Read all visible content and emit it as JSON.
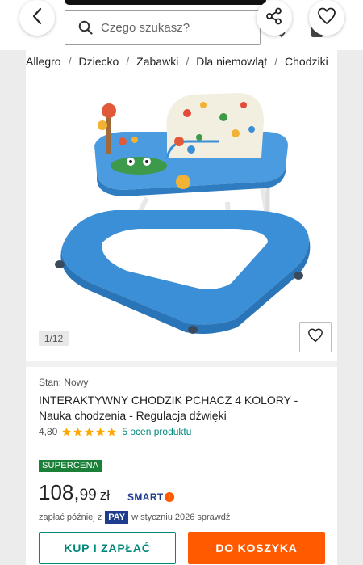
{
  "header": {
    "search_placeholder": "Czego szukasz?"
  },
  "breadcrumb": [
    "Allegro",
    "Dziecko",
    "Zabawki",
    "Dla niemowląt",
    "Chodziki"
  ],
  "gallery": {
    "counter": "1/12"
  },
  "product": {
    "condition": "Stan: Nowy",
    "title": "INTERAKTYWNY CHODZIK PCHACZ 4 KOLORY - Nauka chodzenia - Regulacja dźwięki",
    "rating_value": "4,80",
    "stars": 5,
    "reviews_link": "5 ocen produktu",
    "badge": "SUPERCENA",
    "price_int": "108,",
    "price_dec": "99",
    "currency": "zł",
    "smart_label": "SMART!",
    "pay_later_before": "zapłać później z",
    "pay_logo": "PAY",
    "pay_later_after": "w styczniu 2026 sprawdź"
  },
  "actions": {
    "buy_label": "KUP I ZAPŁAĆ",
    "cart_label": "DO KOSZYKA"
  },
  "colors": {
    "accent": "#00897b",
    "orange": "#ff5a00",
    "badge_green": "#1a7f37",
    "star": "#ffa800",
    "pay_blue": "#1d3c8f"
  }
}
